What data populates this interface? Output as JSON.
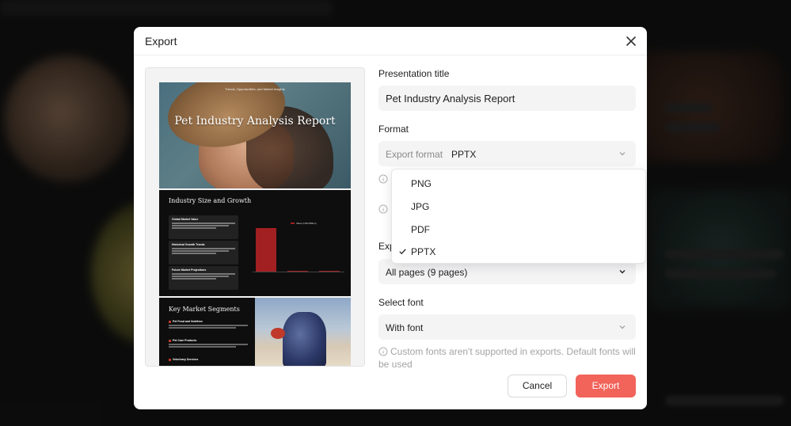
{
  "modal": {
    "title": "Export",
    "presentation_title_label": "Presentation title",
    "presentation_title_value": "Pet Industry Analysis Report",
    "format_label": "Format",
    "export_format_label": "Export format",
    "export_format_value": "PPTX",
    "format_options": [
      "PNG",
      "JPG",
      "PDF",
      "PPTX"
    ],
    "selected_format": "PPTX",
    "export_pages_label_partial": "Exp",
    "export_pages_value": "All pages (9 pages)",
    "select_font_label": "Select font",
    "font_value": "With font",
    "font_hint": "Custom fonts aren't supported in exports. Default fonts will be used",
    "cancel_label": "Cancel",
    "export_label": "Export"
  },
  "preview": {
    "slide1": {
      "tagline": "Trends, Opportunities, and Market Insights",
      "title": "Pet Industry Analysis Report"
    },
    "slide2": {
      "title": "Industry Size and Growth",
      "cards": [
        "Global Market Value",
        "Historical Growth Trends",
        "Future Market Projections"
      ],
      "legend": "Value (USD Billion)"
    },
    "slide3": {
      "title": "Key Market Segments",
      "items": [
        "Pet Food and Nutrition",
        "Pet Care Products",
        "Veterinary Services"
      ]
    }
  },
  "colors": {
    "accent": "#f2635a",
    "chart_bar": "#a21f22"
  }
}
